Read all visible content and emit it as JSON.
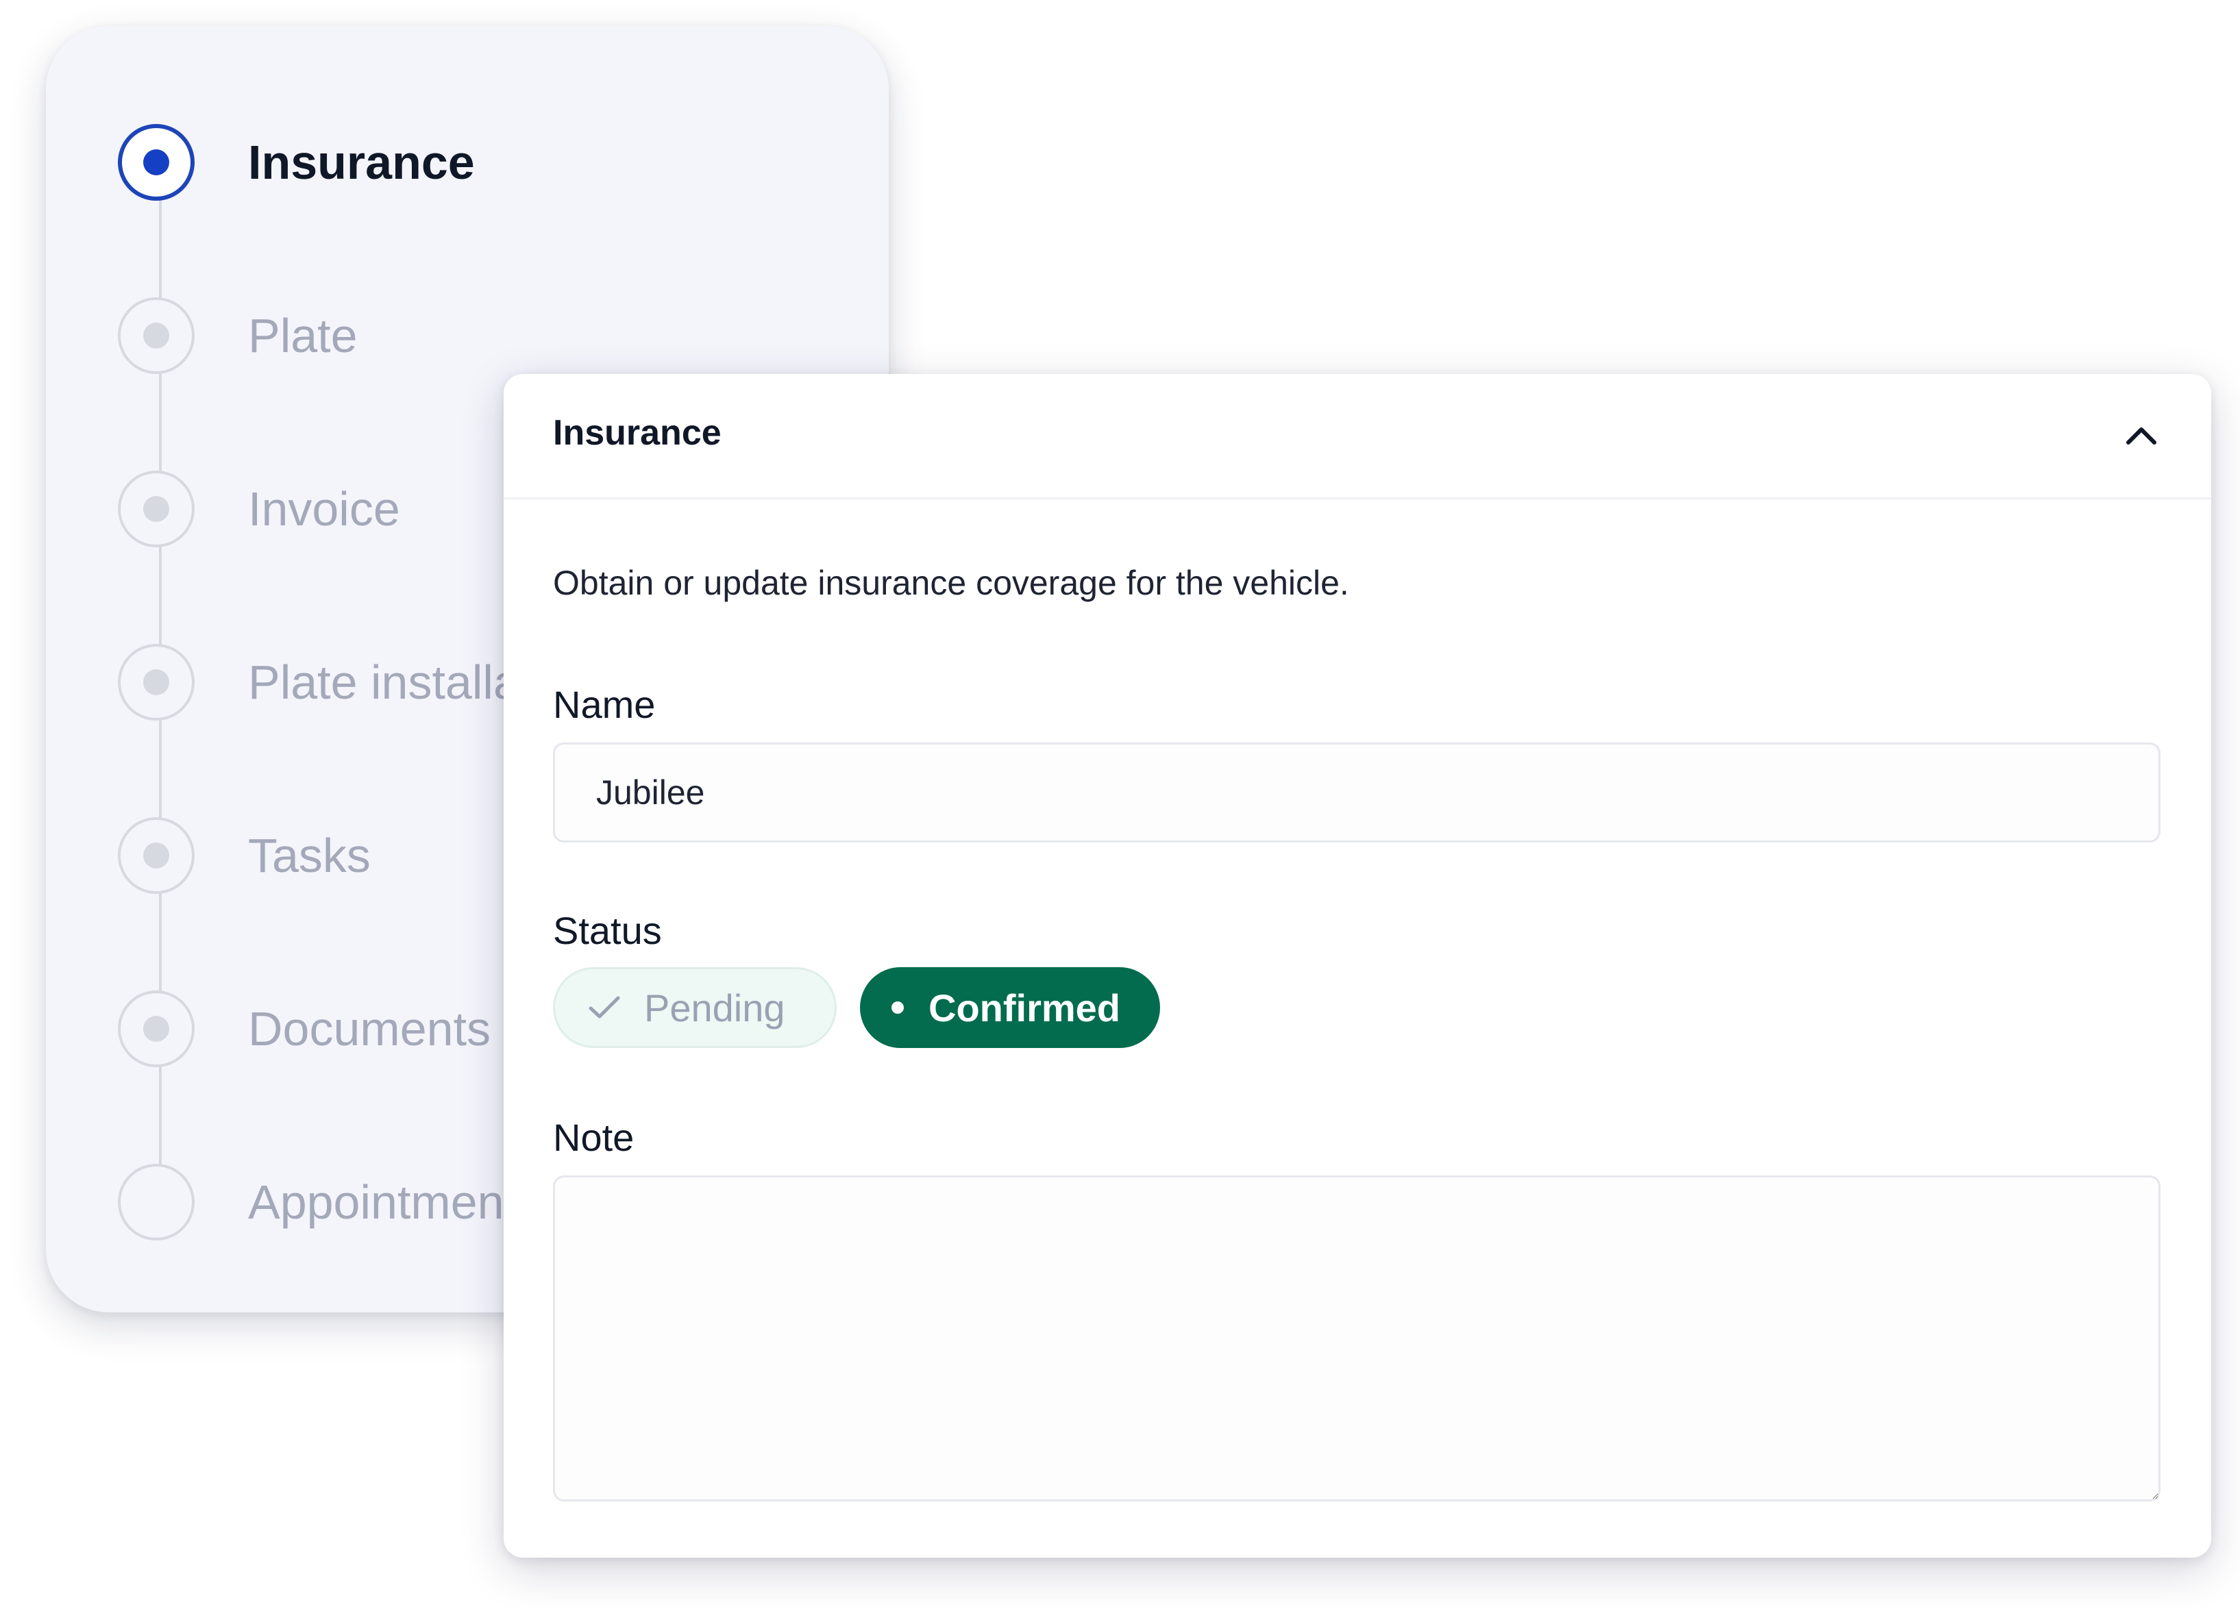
{
  "stepper": {
    "steps": [
      {
        "label": "Insurance",
        "state": "active"
      },
      {
        "label": "Plate",
        "state": "pending"
      },
      {
        "label": "Invoice",
        "state": "pending"
      },
      {
        "label": "Plate installation",
        "state": "pending"
      },
      {
        "label": "Tasks",
        "state": "pending"
      },
      {
        "label": "Documents",
        "state": "pending"
      },
      {
        "label": "Appointment",
        "state": "empty"
      }
    ]
  },
  "form": {
    "title": "Insurance",
    "collapse_icon": "chevron-up-icon",
    "description": "Obtain or update insurance coverage for the vehicle.",
    "name": {
      "label": "Name",
      "value": "Jubilee"
    },
    "status": {
      "label": "Status",
      "options": [
        {
          "label": "Pending",
          "icon": "check-icon",
          "selected": false
        },
        {
          "label": "Confirmed",
          "icon": "bullet-icon",
          "selected": true
        }
      ]
    },
    "note": {
      "label": "Note",
      "value": ""
    }
  },
  "colors": {
    "accent": "#1540c4",
    "confirmed": "#046c4e",
    "pending_bg": "#eef8f4",
    "stepper_bg": "#f4f4fb"
  }
}
